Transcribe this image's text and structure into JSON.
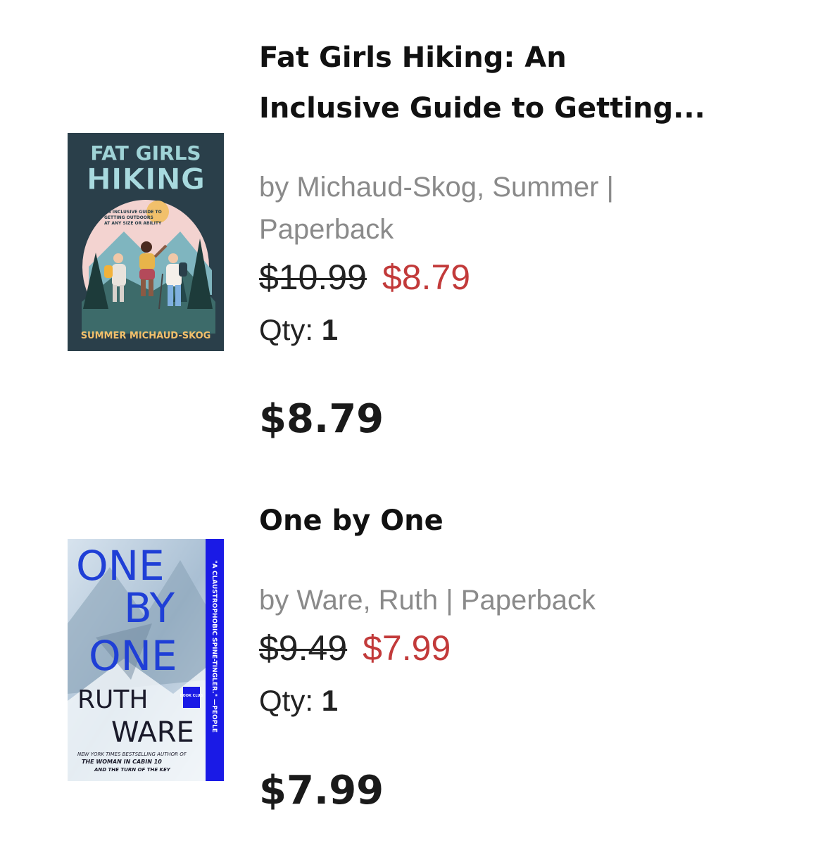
{
  "cart": {
    "items": [
      {
        "title_line1": "Fat Girls Hiking: An",
        "title_line2": "Inclusive Guide to Getting...",
        "byline_line1": "by Michaud-Skog, Summer |",
        "byline_line2": "Paperback",
        "original_price": "$10.99",
        "sale_price": "$8.79",
        "qty_label": "Qty:",
        "qty_value": "1",
        "total": "$8.79",
        "cover": {
          "title_top": "FAT GIRLS",
          "title_bottom": "HIKING",
          "subtitle_1": "AN INCLUSIVE GUIDE TO",
          "subtitle_2": "GETTING OUTDOORS",
          "subtitle_3": "AT ANY SIZE OR ABILITY",
          "author": "SUMMER MICHAUD-SKOG",
          "bg": "#2a3f4a",
          "accent": "#9fd3d6"
        }
      },
      {
        "title_line1": "One by One",
        "byline_line1": "by Ware, Ruth | Paperback",
        "original_price": "$9.49",
        "sale_price": "$7.99",
        "qty_label": "Qty:",
        "qty_value": "1",
        "total": "$7.99",
        "cover": {
          "word1": "ONE",
          "word2": "BY",
          "word3": "ONE",
          "author1": "RUTH",
          "author2": "WARE",
          "badge": "BOOK CLUB",
          "blurb_1": "NEW YORK TIMES BESTSELLING AUTHOR OF",
          "blurb_2": "THE WOMAN IN CABIN 10",
          "blurb_3": "AND THE TURN OF THE KEY",
          "spine_quote": "\"A CLAUSTROPHOBIC SPINE-TINGLER.\" —PEOPLE",
          "title_color": "#1f3fd6",
          "spine_color": "#1a1ae6"
        }
      }
    ]
  },
  "colors": {
    "sale": "#c23a3a",
    "muted": "#8a8a8a"
  }
}
